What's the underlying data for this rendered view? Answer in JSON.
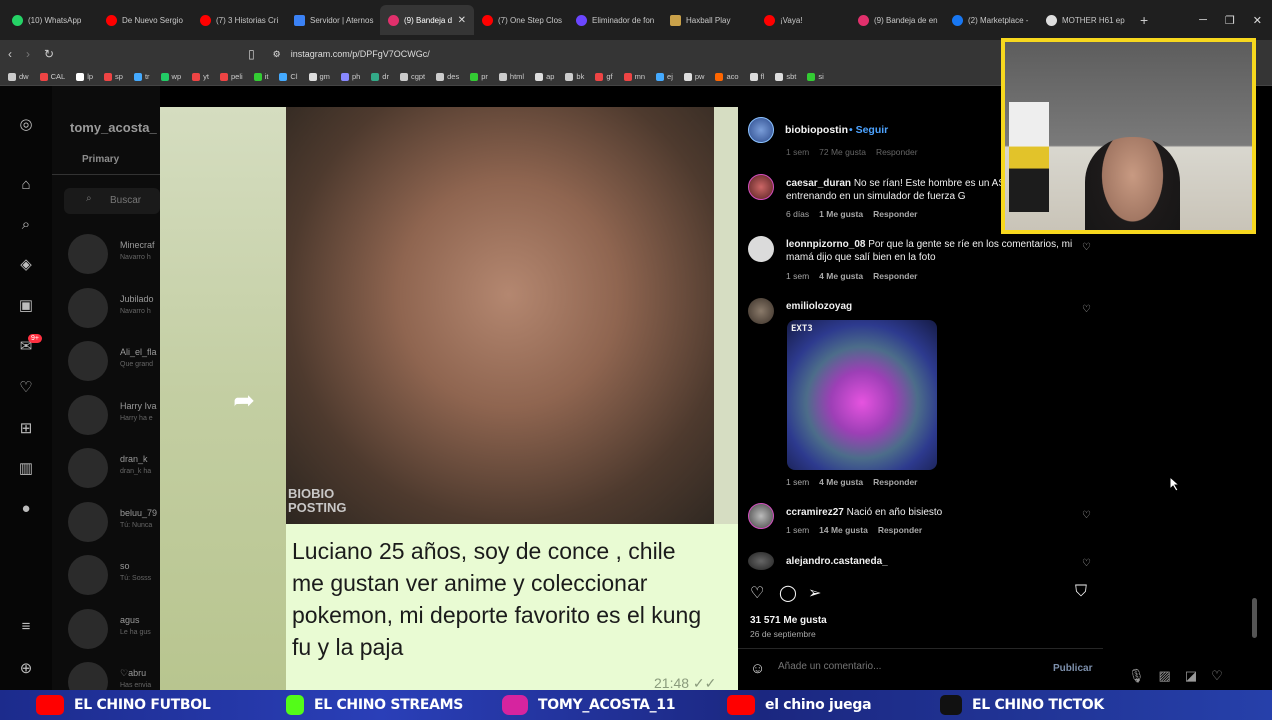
{
  "browser": {
    "tabs": [
      {
        "label": "(10) WhatsApp",
        "color": "#25d366",
        "active": false
      },
      {
        "label": "De Nuevo Sergio",
        "color": "#ff0000",
        "active": false
      },
      {
        "label": "(7) 3 Historias Cri",
        "color": "#ff0000",
        "active": false
      },
      {
        "label": "Servidor | Aternos",
        "color": "#3b82f6",
        "active": false
      },
      {
        "label": "(9) Bandeja d",
        "color": "#e1306c",
        "active": true
      },
      {
        "label": "(7) One Step Clos",
        "color": "#ff0000",
        "active": false
      },
      {
        "label": "Eliminador de fon",
        "color": "#6b46ff",
        "active": false
      },
      {
        "label": "Haxball Play",
        "color": "#c9a14a",
        "active": false
      },
      {
        "label": "¡Vaya!",
        "color": "#ff0000",
        "active": false
      },
      {
        "label": "(9) Bandeja de en",
        "color": "#e1306c",
        "active": false
      },
      {
        "label": "(2) Marketplace -",
        "color": "#1877f2",
        "active": false
      },
      {
        "label": "MOTHER H61 ep",
        "color": "#dddddd",
        "active": false
      }
    ],
    "new_tab": "+",
    "url": "instagram.com/p/DPFgV7OCWGc/",
    "bookmarks": [
      "dw",
      "CAL",
      "lp",
      "sp",
      "tr",
      "wp",
      "yt",
      "peli",
      "it",
      "Cl",
      "gm",
      "ph",
      "dr",
      "cgpt",
      "des",
      "pr",
      "html",
      "ap",
      "bk",
      "gf",
      "mn",
      "ej",
      "pw",
      "aco",
      "fl",
      "sbt",
      "si"
    ],
    "bookmark_colors": [
      "#ccc",
      "#e44",
      "#fff",
      "#e44",
      "#4af",
      "#2c6",
      "#e44",
      "#e44",
      "#3c3",
      "#4af",
      "#ddd",
      "#88f",
      "#3a8",
      "#ccc",
      "#ccc",
      "#3c3",
      "#ccc",
      "#ddd",
      "#ccc",
      "#e44",
      "#e44",
      "#4af",
      "#ddd",
      "#f60",
      "#ddd",
      "#ddd",
      "#3c3"
    ]
  },
  "instagram": {
    "dm_username": "tomy_acosta_",
    "primary_tab": "Primary",
    "search_placeholder": "Buscar",
    "conversations": [
      {
        "name": "Minecraf",
        "preview": "Navarro h"
      },
      {
        "name": "Jubilado",
        "preview": "Navarro h"
      },
      {
        "name": "Ali_el_fla",
        "preview": "Que grand"
      },
      {
        "name": "Harry Iva",
        "preview": "Harry ha e"
      },
      {
        "name": "dran_k",
        "preview": "dran_k ha"
      },
      {
        "name": "beluu_79",
        "preview": "Tú: Nunca"
      },
      {
        "name": "so",
        "preview": "Tú: Sosss"
      },
      {
        "name": "agus",
        "preview": "Le ha gus"
      },
      {
        "name": "♡abru",
        "preview": "Has envia"
      }
    ],
    "notif_badge": "9+"
  },
  "post": {
    "watermark_line1": "BIOBIO",
    "watermark_line2": "POSTING",
    "caption": "Luciano 25 años, soy de conce , chile me gustan ver anime y coleccionar pokemon, mi deporte favorito es el kung fu y la paja",
    "time": "21:48 ✓✓"
  },
  "comments_panel": {
    "author": "biobiopostin",
    "follow": "• Seguir",
    "top_meta": {
      "time": "1 sem",
      "likes": "72 Me gusta",
      "reply": "Responder"
    },
    "comments": [
      {
        "user": "caesar_duran",
        "text": "No se rían! Este hombre es un AST Está entrenando en un simulador de fuerza G",
        "time": "6 días",
        "likes": "1 Me gusta",
        "reply": "Responder"
      },
      {
        "user": "leonnpizorno_08",
        "text": "Por que la gente se ríe en los comentarios, mi mamá dijo que salí bien en la foto",
        "time": "1 sem",
        "likes": "4 Me gusta",
        "reply": "Responder"
      },
      {
        "user": "emiliolozoyag",
        "text": "",
        "time": "1 sem",
        "likes": "4 Me gusta",
        "reply": "Responder"
      },
      {
        "user": "ccramirez27",
        "text": "Nació en año bisiesto",
        "time": "1 sem",
        "likes": "14 Me gusta",
        "reply": "Responder"
      },
      {
        "user": "alejandro.castaneda_",
        "text": ""
      }
    ],
    "sticker_label": "EXT3",
    "likes_total": "31 571 Me gusta",
    "date": "26 de septiembre",
    "comment_placeholder": "Añade un comentario...",
    "publish": "Publicar"
  },
  "overlay": {
    "items": [
      {
        "label": "EL CHINO FUTBOL",
        "icon_color": "#ff0000"
      },
      {
        "label": "EL CHINO STREAMS",
        "icon_color": "#53fc18"
      },
      {
        "label": "TOMY_ACOSTA_11",
        "icon_color": "#d6249f"
      },
      {
        "label": "el chino juega",
        "icon_color": "#ff0000"
      },
      {
        "label": "EL CHINO TICTOK",
        "icon_color": "#111111"
      }
    ]
  }
}
